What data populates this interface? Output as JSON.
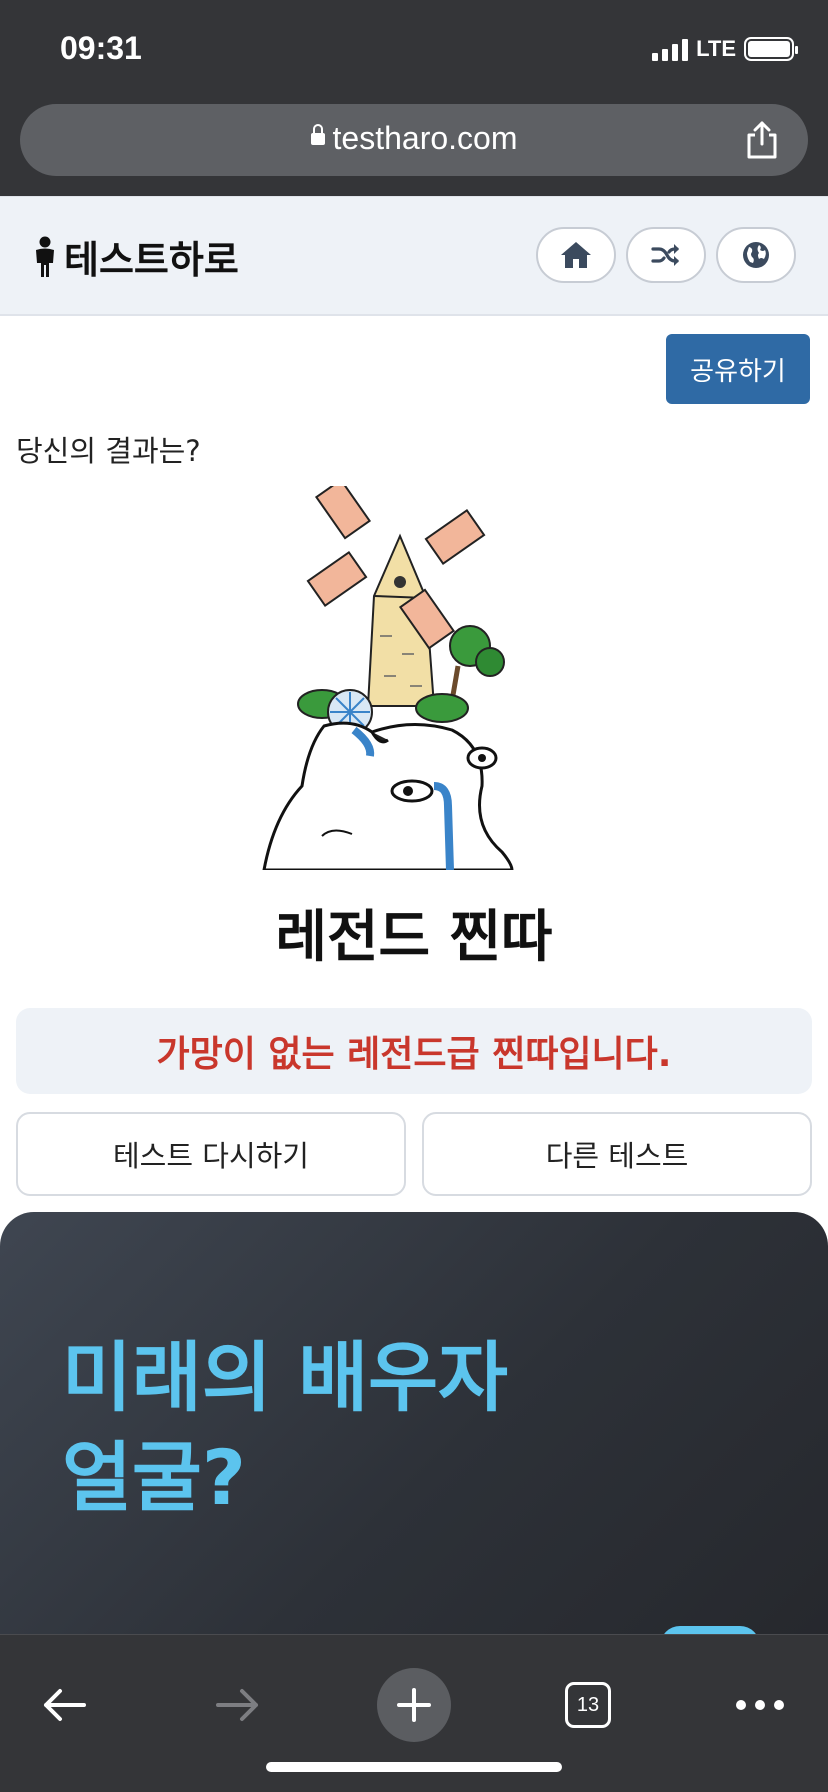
{
  "status_bar": {
    "time": "09:31",
    "network": "LTE"
  },
  "browser": {
    "url": "testharo.com",
    "tab_count": "13"
  },
  "site_header": {
    "brand": "테스트하로",
    "icons": [
      "person-icon",
      "home-icon",
      "shuffle-icon",
      "globe-icon"
    ]
  },
  "content": {
    "share_label": "공유하기",
    "question": "당신의 결과는?",
    "result_title": "레전드 찐따",
    "result_description": "가망이 없는 레전드급 찐따입니다.",
    "retry_label": "테스트 다시하기",
    "other_label": "다른 테스트"
  },
  "promo": {
    "line1": "미래의 배우자",
    "line2": "얼굴?"
  },
  "colors": {
    "accent_blue": "#2f6aa5",
    "description_red": "#c9372c",
    "promo_cyan": "#5cc4ee",
    "chrome_dark": "#343538"
  }
}
